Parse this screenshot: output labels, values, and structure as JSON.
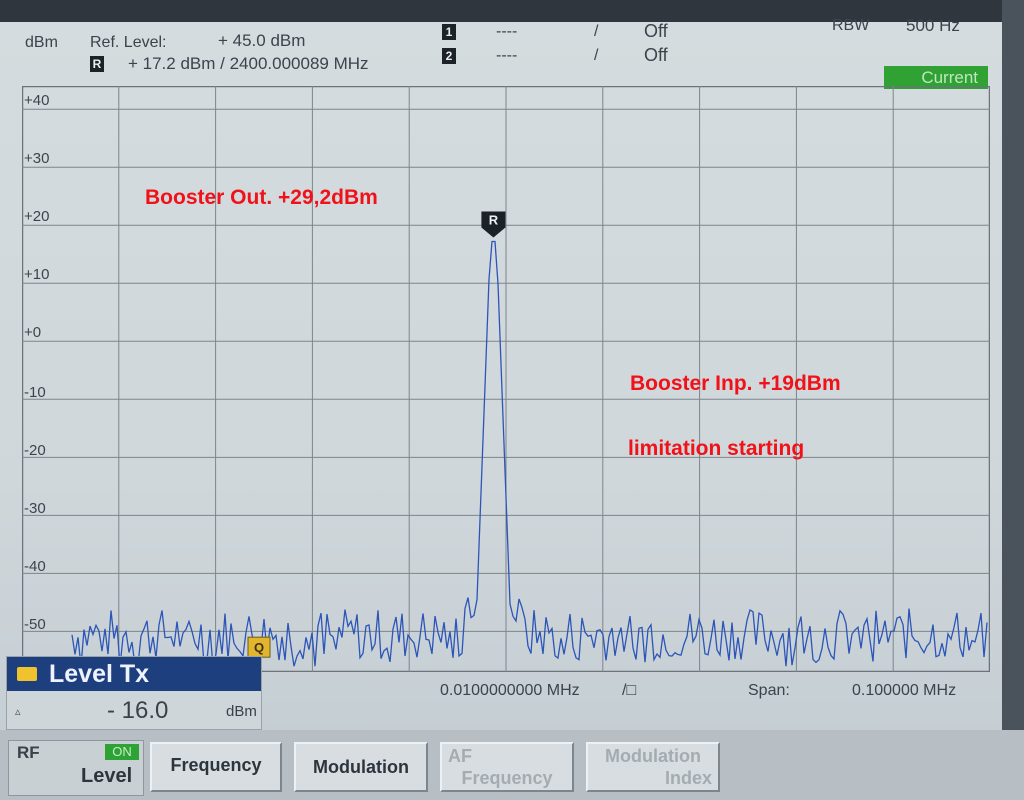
{
  "header": {
    "unit": "dBm",
    "ref_level_label": "Ref. Level:",
    "ref_level_value": "+ 45.0  dBm",
    "marker_r_readout": "+ 17.2  dBm  /   2400.000089   MHz",
    "marker1": {
      "icon": "marker-1-icon",
      "label": "1",
      "value": "----",
      "sep": "/",
      "state": "Off"
    },
    "marker2": {
      "icon": "marker-2-icon",
      "label": "2",
      "value": "----",
      "sep": "/",
      "state": "Off"
    },
    "rbw_label": "RBW",
    "rbw_value": "500 Hz",
    "current_badge": "Current"
  },
  "y_ticks": [
    "+40",
    "+30",
    "+20",
    "+10",
    "+0",
    "-10",
    "-20",
    "-30",
    "-40",
    "-50"
  ],
  "annotations": {
    "booster_out": "Booster Out. +29,2dBm",
    "booster_inp": "Booster Inp. +19dBm",
    "limitation": "limitation starting"
  },
  "marker_tag": "R",
  "q_tag": "Q",
  "freq_row": {
    "center": "0.0100000000 MHz",
    "center_suffix": "/□",
    "span_label": "Span:",
    "span_value": "0.100000  MHz"
  },
  "level_tx": {
    "title": "Level Tx",
    "triangle": "▵",
    "value": "- 16.0",
    "unit": "dBm"
  },
  "softkeys": {
    "rf": {
      "label": "RF",
      "state": "ON",
      "sub": "Level"
    },
    "frequency": "Frequency",
    "modulation": "Modulation",
    "af_frequency": {
      "line1": "AF",
      "line2": "Frequency"
    },
    "modulation_index": {
      "line1": "Modulation",
      "line2": "Index"
    }
  },
  "chart_data": {
    "type": "line",
    "y_unit": "dBm",
    "ylim": [
      -57,
      44
    ],
    "y_ticks": [
      40,
      30,
      20,
      10,
      0,
      -10,
      -20,
      -30,
      -40,
      -50
    ],
    "x_center_label": "0.0100000000 MHz",
    "span_label": "0.100000 MHz",
    "grid": true,
    "peak": {
      "marker": "R",
      "level_dbm": 17.2,
      "frequency_mhz": 2400.000089,
      "x_fraction": 0.487
    },
    "noise_floor_dbm": -53,
    "trace_color": "#2c55b8"
  }
}
